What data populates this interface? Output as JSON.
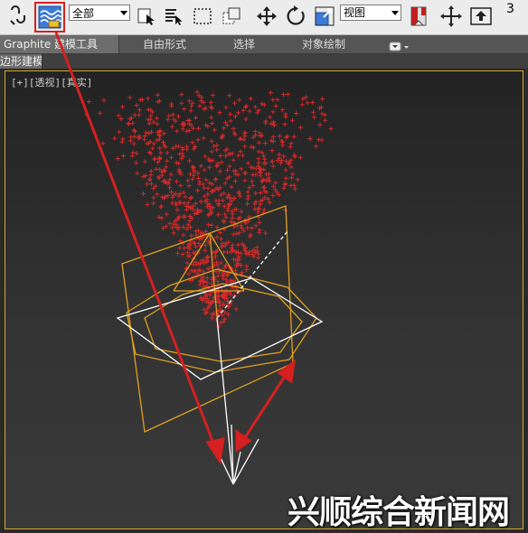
{
  "toolbar": {
    "select_filter": "全部",
    "ref_coord_system": "视图",
    "snap_value": "3",
    "icons": [
      "select-link-icon",
      "bind-space-warp-icon",
      "select-object-icon",
      "select-by-name-icon",
      "rect-selection-region-icon",
      "window-crossing-icon",
      "select-move-icon",
      "select-rotate-icon",
      "select-scale-icon",
      "pivot-center-icon",
      "select-manipulate-icon",
      "keyboard-shortcut-override-icon"
    ]
  },
  "ribbon": {
    "tabs": [
      "Graphite 建模工具",
      "自由形式",
      "选择",
      "对象绘制"
    ],
    "active_tab": "Graphite 建模工具",
    "subtab": "多边形建模"
  },
  "viewport": {
    "label_plus": "[+]",
    "label_view": "[透视]",
    "label_shading": "[真实]",
    "border_color": "#d8a830"
  },
  "annotations": {
    "arrow_color": "#d42020",
    "highlight": "bind-space-warp-icon"
  },
  "scene_colors": {
    "particles": "#d62828",
    "gizmo_orange": "#e0a020",
    "gizmo_white": "#ffffff"
  },
  "watermark": "兴顺综合新闻网"
}
